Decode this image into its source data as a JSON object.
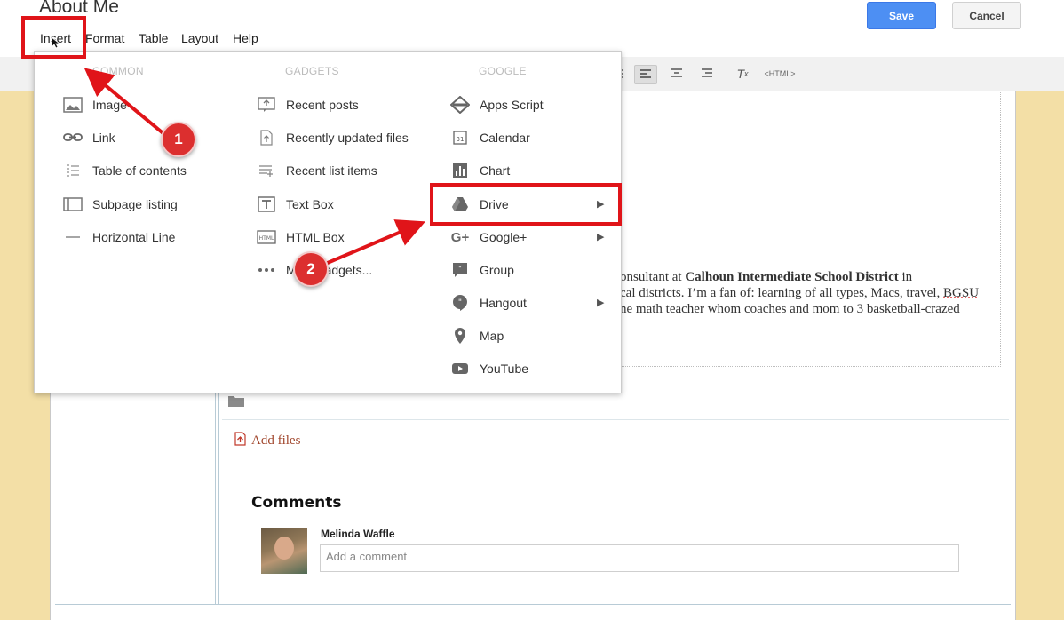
{
  "page": {
    "title": "About Me"
  },
  "menubar": {
    "items": [
      "Insert",
      "Format",
      "Table",
      "Layout",
      "Help"
    ]
  },
  "actions": {
    "save_label": "Save",
    "cancel_label": "Cancel"
  },
  "toolbar": {
    "html_label": "<HTML>"
  },
  "insert_menu": {
    "columns": [
      {
        "heading": "COMMON",
        "items": [
          {
            "label": "Image",
            "icon": "image-icon"
          },
          {
            "label": "Link",
            "icon": "link-icon"
          },
          {
            "label": "Table of contents",
            "icon": "toc-icon"
          },
          {
            "label": "Subpage listing",
            "icon": "subpage-icon"
          },
          {
            "label": "Horizontal Line",
            "icon": "horizontal-line-icon"
          }
        ]
      },
      {
        "heading": "GADGETS",
        "items": [
          {
            "label": "Recent posts",
            "icon": "recent-posts-icon"
          },
          {
            "label": "Recently updated files",
            "icon": "recent-files-icon"
          },
          {
            "label": "Recent list items",
            "icon": "recent-list-icon"
          },
          {
            "label": "Text Box",
            "icon": "text-box-icon"
          },
          {
            "label": "HTML Box",
            "icon": "html-box-icon"
          },
          {
            "label": "More gadgets...",
            "icon": "more-icon"
          }
        ]
      },
      {
        "heading": "GOOGLE",
        "items": [
          {
            "label": "Apps Script",
            "icon": "apps-script-icon"
          },
          {
            "label": "Calendar",
            "icon": "calendar-icon"
          },
          {
            "label": "Chart",
            "icon": "chart-icon"
          },
          {
            "label": "Drive",
            "icon": "drive-icon",
            "submenu": true
          },
          {
            "label": "Google+",
            "icon": "google-plus-icon",
            "submenu": true
          },
          {
            "label": "Group",
            "icon": "group-icon"
          },
          {
            "label": "Hangout",
            "icon": "hangout-icon",
            "submenu": true
          },
          {
            "label": "Map",
            "icon": "map-icon"
          },
          {
            "label": "YouTube",
            "icon": "youtube-icon"
          }
        ]
      }
    ]
  },
  "content": {
    "line1_pre": "onsultant at ",
    "line1_bold": "Calhoun Intermediate School District",
    "line1_post": " in",
    "line2_pre": "cal districts. I’m a fan of: learning of all types, Macs, travel, ",
    "line2_underlined": "BGSU",
    "line3": "ne math teacher whom coaches and mom to 3 basketball-crazed"
  },
  "files": {
    "add_label": "Add files"
  },
  "comments": {
    "heading": "Comments",
    "commenter": "Melinda Waffle",
    "placeholder": "Add a comment"
  },
  "annotations": {
    "badge1": "1",
    "badge2": "2"
  },
  "colors": {
    "annotation_red": "#e01419",
    "save_blue": "#4d8ff3",
    "background_tan": "#f3dfa6"
  }
}
